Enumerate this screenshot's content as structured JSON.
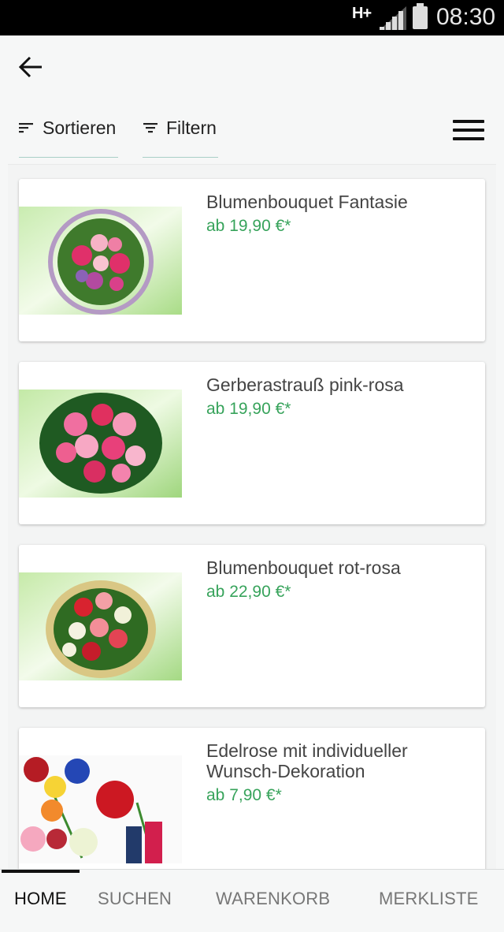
{
  "status_bar": {
    "network": "H+",
    "time": "08:30"
  },
  "toolbar": {
    "sort_label": "Sortieren",
    "filter_label": "Filtern"
  },
  "products": [
    {
      "title": "Blumenbouquet Fantasie",
      "price": "ab 19,90 €*"
    },
    {
      "title": "Gerberastrauß pink-rosa",
      "price": "ab 19,90 €*"
    },
    {
      "title": "Blumenbouquet rot-rosa",
      "price": "ab 22,90 €*"
    },
    {
      "title": "Edelrose mit individueller Wunsch-Dekoration",
      "price": "ab 7,90 €*"
    }
  ],
  "bottom_nav": {
    "home": "HOME",
    "search": "SUCHEN",
    "cart": "WARENKORB",
    "wishlist": "MERKLISTE",
    "active": "HOME"
  },
  "colors": {
    "price": "#37a35b",
    "underline": "#a8cfc6",
    "background": "#f6f7f7"
  }
}
